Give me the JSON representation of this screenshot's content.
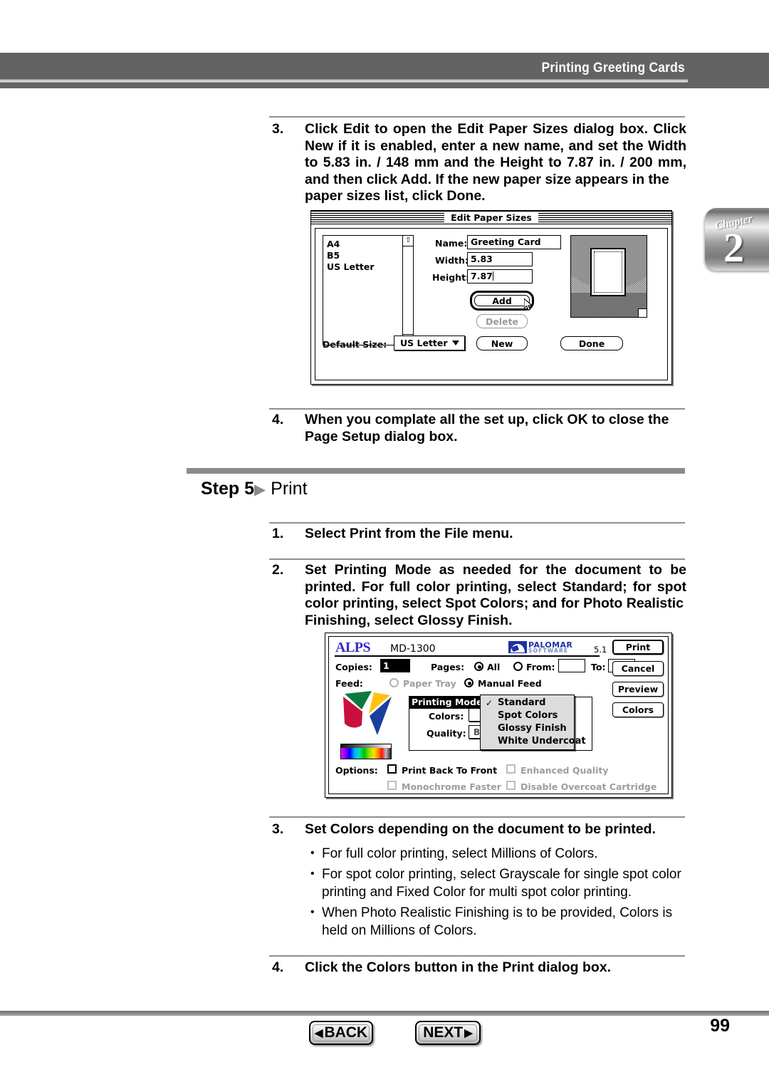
{
  "header": {
    "title": "Printing Greeting Cards"
  },
  "chapter_tab": {
    "word": "Chapter",
    "number": "2"
  },
  "steps": [
    {
      "num": "3.",
      "lines": [
        "Click Edit to open the Edit Paper Sizes dialog box. Click",
        "New if it is enabled, enter a new name, and set the Width",
        "to 5.83 in. / 148 mm and the Height to 7.87 in. / 200 mm,",
        "and then click Add. If the new paper size appears in the",
        "paper sizes list, click Done."
      ]
    },
    {
      "num": "4.",
      "lines": [
        "When you complate all the set up, click OK to close the",
        "Page Setup dialog box."
      ]
    }
  ],
  "step_heading": {
    "label": "Step 5",
    "arrow": "▶",
    "title": "Print"
  },
  "print_steps": [
    {
      "num": "1.",
      "lines": [
        "Select Print from the File menu."
      ]
    },
    {
      "num": "2.",
      "lines": [
        "Set Printing Mode as needed for the document to be",
        "printed. For full color printing, select Standard; for spot",
        "color printing, select Spot Colors; and for Photo Realistic",
        "Finishing, select Glossy Finish."
      ]
    },
    {
      "num": "3.",
      "lines": [
        "Set Colors depending on the document to be printed."
      ]
    },
    {
      "num": "4.",
      "lines": [
        "Click the Colors button in the Print dialog box."
      ]
    }
  ],
  "bullets": [
    "For full color printing, select Millions of Colors.",
    "For spot color printing, select Grayscale for single spot color printing and Fixed Color for multi spot color printing.",
    "When Photo Realistic Finishing is to be provided, Colors is held on Millions of Colors."
  ],
  "edit_paper_dialog": {
    "title": "Edit Paper Sizes",
    "list_items": [
      "A4",
      "B5",
      "US Letter"
    ],
    "scroll_up_icon": "⇧",
    "scroll_down_icon": "⇩",
    "name_label": "Name:",
    "name_value": "Greeting Card",
    "width_label": "Width:",
    "width_value": "5.83",
    "height_label": "Height:",
    "height_value": "7.87",
    "add_button": "Add",
    "delete_button": "Delete",
    "new_button": "New",
    "done_button": "Done",
    "default_size_label": "Default Size:",
    "default_size_value": "US Letter",
    "cursor_icon": "pointer-arrow-cursor"
  },
  "print_dialog": {
    "brand": "ALPS",
    "model": "MD-1300",
    "partner_name_line1": "PALOMAR",
    "partner_name_line2": "SOFTWARE",
    "version": "5.1",
    "copies_label": "Copies:",
    "copies_value": "1",
    "pages_label": "Pages:",
    "pages_all": "All",
    "pages_from": "From:",
    "pages_to": "To:",
    "from_value": "",
    "to_value": "",
    "feed_label": "Feed:",
    "feed_paper_tray": "Paper Tray",
    "feed_manual": "Manual Feed",
    "printing_mode_label": "Printing Mode:",
    "printing_mode_menu": [
      {
        "label": "Standard",
        "checked": true
      },
      {
        "label": "Spot Colors",
        "checked": false
      },
      {
        "label": "Glossy Finish",
        "checked": false
      },
      {
        "label": "White Undercoat",
        "checked": false
      }
    ],
    "check_mark": "✓",
    "colors_label": "Colors:",
    "quality_label": "Quality:",
    "quality_value": "Best (600dpi)",
    "options_label": "Options:",
    "options": [
      {
        "label": "Print Back To Front",
        "disabled": false
      },
      {
        "label": "Enhanced Quality",
        "disabled": true
      },
      {
        "label": "Monochrome Faster",
        "disabled": true
      },
      {
        "label": "Disable Overcoat Cartridge",
        "disabled": true
      }
    ],
    "buttons": [
      {
        "label": "Print",
        "default": true
      },
      {
        "label": "Cancel",
        "default": false
      },
      {
        "label": "Preview",
        "default": false
      },
      {
        "label": "Colors",
        "default": false
      }
    ]
  },
  "footer": {
    "back_label": "BACK",
    "back_arrow": "◀",
    "next_label": "NEXT",
    "next_arrow": "▶",
    "page_number": "99"
  }
}
